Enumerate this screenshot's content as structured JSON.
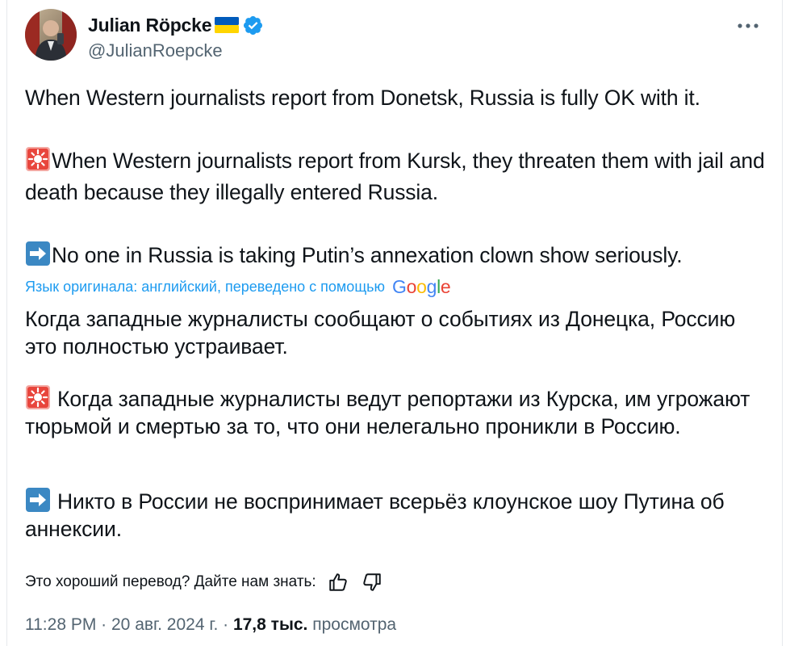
{
  "author": {
    "name": "Julian Röpcke",
    "handle": "@JulianRoepcke"
  },
  "icons": {
    "flag": "ukraine-flag-icon",
    "verified": "verified-badge-icon",
    "more": "more-options-icon",
    "siren": "rotating-light-emoji",
    "arrow": "right-arrow-emoji",
    "thumbs_up": "thumbs-up-icon",
    "thumbs_down": "thumbs-down-icon"
  },
  "colors": {
    "accent": "#1d9bf0",
    "text": "#0f1419",
    "muted": "#536471",
    "flag_blue": "#005bbb",
    "flag_yellow": "#ffd500"
  },
  "original": {
    "line1": "When Western journalists report from Donetsk, Russia is fully OK with it.",
    "line2": "When Western journalists report from Kursk, they threaten them with jail and death because they illegally entered Russia.",
    "line3": "No one  in Russia is taking Putin’s annexation clown show seriously."
  },
  "translation": {
    "note": "Язык оригинала: английский, переведено с помощью",
    "provider": "Google",
    "para1": "Когда западные журналисты сообщают о событиях из Донецка, Россию это полностью устраивает.",
    "para2": "Когда западные журналисты ведут репортажи из Курска, им угрожают тюрьмой и смертью за то, что они нелегально проникли в Россию.",
    "para3": "Никто в России не воспринимает всерьёз клоунское шоу Путина об аннексии."
  },
  "feedback": {
    "question": "Это хороший перевод? Дайте нам знать:"
  },
  "meta": {
    "time": "11:28 PM",
    "separator": " · ",
    "date": "20 авг. 2024 г.",
    "views_count": "17,8 тыс.",
    "views_label": "просмотра"
  }
}
